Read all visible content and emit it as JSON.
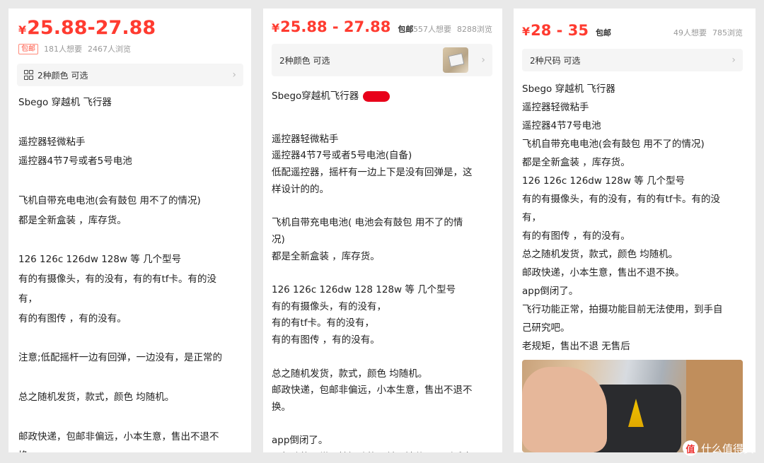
{
  "panel1": {
    "currency": "¥",
    "price": "25.88-27.88",
    "tag": "包邮",
    "wants": "181人想要",
    "views": "2467人浏览",
    "option_label": "2种颜色 可选",
    "lines": [
      "Sbego 穿越机 飞行器",
      "",
      "遥控器轻微粘手",
      "遥控器4节7号或者5号电池",
      "",
      "飞机自带充电电池(会有鼓包 用不了的情况)",
      "都是全新盒装 ，库存货。",
      "",
      "126 126c 126dw 128w 等 几个型号",
      "有的有摄像头，有的没有，有的有tf卡。有的没",
      "有，",
      "有的有图传 ，有的没有。",
      "",
      "注意;低配摇杆一边有回弹，一边没有，是正常的",
      "",
      "总之随机发货，款式，颜色 均随机。",
      "",
      "邮政快递，包邮非偏远，小本生意，售出不退不",
      "换"
    ]
  },
  "panel2": {
    "currency": "¥",
    "price": "25.88 - 27.88",
    "tag": "包邮",
    "wants": "557人想要",
    "views": "8288浏览",
    "option_label": "2种颜色 可选",
    "title_line": "Sbego穿越机飞行器",
    "lines": [
      "",
      "遥控器轻微粘手",
      "遥控器4节7号或者5号电池(自备)",
      "低配遥控器，摇杆有一边上下是没有回弹是，这",
      "样设计的的。",
      "",
      "飞机自带充电电池( 电池会有鼓包 用不了的情",
      "况)",
      "都是全新盒装 ，库存货。",
      "",
      "126 126c 126dw 128 128w 等 几个型号",
      "有的有摄像头，有的没有，",
      "有的有tf卡。有的没有，",
      "有的有图传 ，有的没有。",
      "",
      "总之随机发货，款式，颜色 均随机。",
      "邮政快递，包邮非偏远，小本生意，售出不退不",
      "换。",
      "",
      "app倒闭了。",
      "飞行功能正常，拍摄功能目前无法使用，到手自"
    ]
  },
  "panel3": {
    "currency": "¥",
    "price": "28 - 35",
    "tag": "包邮",
    "wants": "49人想要",
    "views": "785浏览",
    "option_label": "2种尺码 可选",
    "lines": [
      "Sbego 穿越机 飞行器",
      "遥控器轻微粘手",
      "遥控器4节7号电池",
      "飞机自带充电电池(会有鼓包 用不了的情况)",
      "都是全新盒装 ，库存货。",
      "126 126c 126dw 128w 等 几个型号",
      "有的有摄像头，有的没有，有的有tf卡。有的没",
      "有，",
      "有的有图传 ，有的没有。",
      "总之随机发货，款式，颜色 均随机。",
      "邮政快递，小本生意，售出不退不换。",
      "app倒闭了。",
      "飞行功能正常，拍摄功能目前无法使用，到手自",
      "己研究吧。",
      "老规矩，售出不退 无售后"
    ]
  },
  "watermark": {
    "text": "什么值得买",
    "icon_char": "值"
  },
  "colors": {
    "price_red": "#ff3b30",
    "background": "#e9e9e9"
  }
}
